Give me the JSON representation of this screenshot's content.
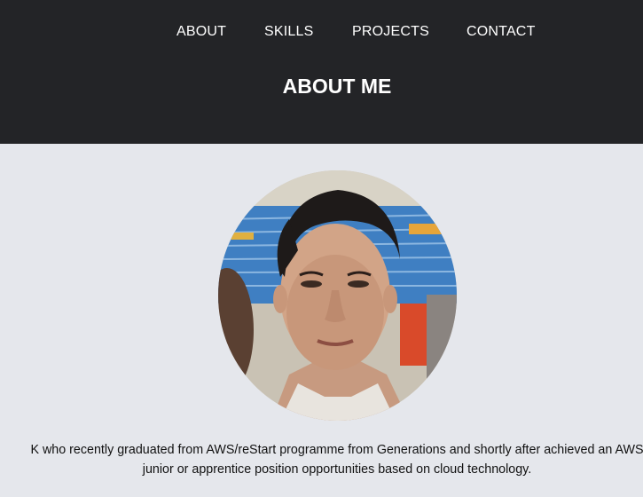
{
  "nav": {
    "items": [
      {
        "label": "ABOUT"
      },
      {
        "label": "SKILLS"
      },
      {
        "label": "PROJECTS"
      },
      {
        "label": "CONTACT"
      }
    ]
  },
  "header": {
    "title": "ABOUT ME"
  },
  "profile": {
    "photo_icon": "profile-photo",
    "bio_line_1": "K who recently graduated from AWS/reStart programme from Generations and shortly after achieved an AWS",
    "bio_line_2": "junior or apprentice position opportunities based on cloud technology."
  },
  "colors": {
    "header_bg": "#232427",
    "page_bg": "#e5e7ec",
    "nav_text": "#ffffff"
  }
}
